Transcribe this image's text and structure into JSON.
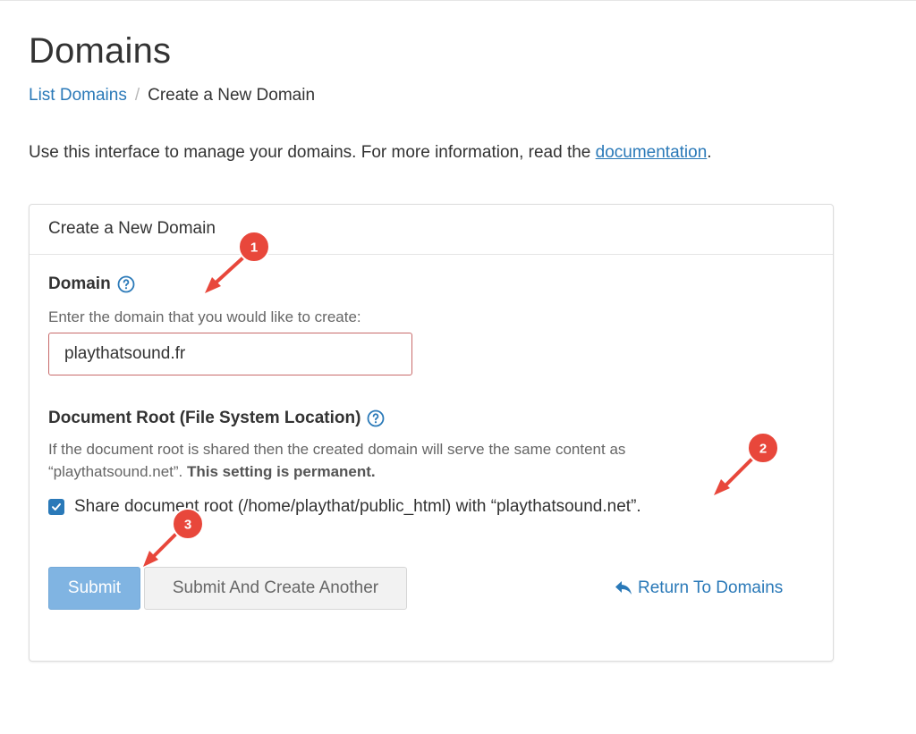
{
  "page": {
    "title": "Domains"
  },
  "breadcrumb": {
    "link": "List Domains",
    "separator": "/",
    "current": "Create a New Domain"
  },
  "intro": {
    "text": "Use this interface to manage your domains. For more information, read the ",
    "link": "documentation",
    "suffix": "."
  },
  "panel": {
    "heading": "Create a New Domain",
    "domain": {
      "label": "Domain",
      "help": "Enter the domain that you would like to create:",
      "value": "playthatsound.fr"
    },
    "docroot": {
      "label": "Document Root (File System Location)",
      "help": "If the document root is shared then the created domain will serve the same content as “playthatsound.net”.",
      "permanent": "This setting is permanent.",
      "share_label": "Share document root (/home/playthat/public_html) with “playthatsound.net”.",
      "share_checked": true
    },
    "buttons": {
      "submit": "Submit",
      "submit_another": "Submit And Create Another",
      "return": "Return To Domains"
    }
  },
  "annotations": [
    "1",
    "2",
    "3"
  ],
  "colors": {
    "link": "#2a79b8",
    "submit": "#80b4e2",
    "annotation": "#e8473b"
  },
  "icons": [
    "question-circle-icon",
    "checkmark-icon",
    "reply-arrow-icon"
  ]
}
